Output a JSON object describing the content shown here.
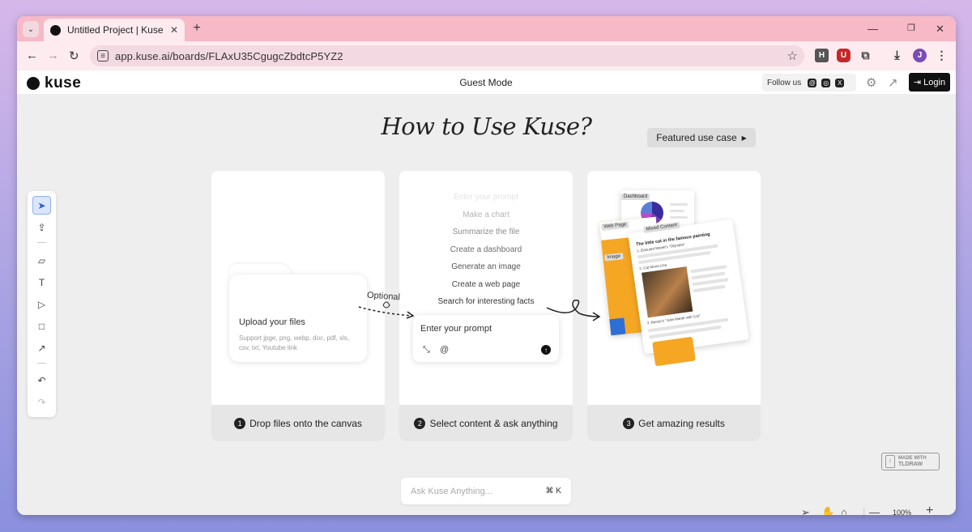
{
  "browser": {
    "tab_title": "Untitled Project | Kuse",
    "tab_menu_icon": "chevron-down-icon",
    "new_tab_label": "+",
    "url": "app.kuse.ai/boards/FLAxU35CgugcZbdtcP5YZ2",
    "extensions": [
      {
        "name": "honey-extension-icon",
        "label": "H",
        "color": "#555555"
      },
      {
        "name": "ublock-extension-icon",
        "label": "U",
        "color": "#c62828"
      },
      {
        "name": "puzzle-extensions-icon",
        "label": "",
        "color": "#444444"
      }
    ],
    "profile_initial": "J",
    "profile_color": "#7b4bb7"
  },
  "header": {
    "logo_text": "kuse",
    "mode_label": "Guest Mode",
    "follow_label": "Follow us",
    "login_label": "Login"
  },
  "main": {
    "heading": "How to Use Kuse?",
    "featured_label": "Featured use case",
    "optional_label": "Optional",
    "steps": [
      {
        "num": "1",
        "label": "Drop files onto the canvas"
      },
      {
        "num": "2",
        "label": "Select content & ask anything"
      },
      {
        "num": "3",
        "label": "Get amazing results"
      }
    ],
    "upload": {
      "title": "Upload your files",
      "subtitle": "Support jpge, png, webp, doc, pdf, xls, csv, txt, Youtube link"
    },
    "suggestions": [
      "Enter your prompt",
      "Make a chart",
      "Summarize the file",
      "Create a dashboard",
      "Generate an image",
      "Create a web page",
      "Search for interesting facts"
    ],
    "prompt_placeholder": "Enter your prompt",
    "result_labels": {
      "dashboard": "Dashboard",
      "web_page": "Web Page",
      "image": "Image",
      "mixed": "Mixed Content",
      "mixed_title": "The little cat in the famous painting",
      "item1": "1. Édouard Manet's \"Olympia\"",
      "item2": "2. Cat Mona Lisa",
      "item3": "3. Renoir's \"Julie Manet with Cat\""
    }
  },
  "branding": {
    "made_with": "MADE WITH",
    "tldraw": "TLDRAW"
  },
  "ask": {
    "placeholder": "Ask Kuse Anything...",
    "shortcut": "⌘ K"
  },
  "zoom": {
    "level": "100%"
  },
  "colors": {
    "accent": "#111111",
    "tab_bar": "#f7b9c6",
    "canvas": "#eeeeee",
    "orange": "#f5a623",
    "blue": "#2d6fd6"
  }
}
